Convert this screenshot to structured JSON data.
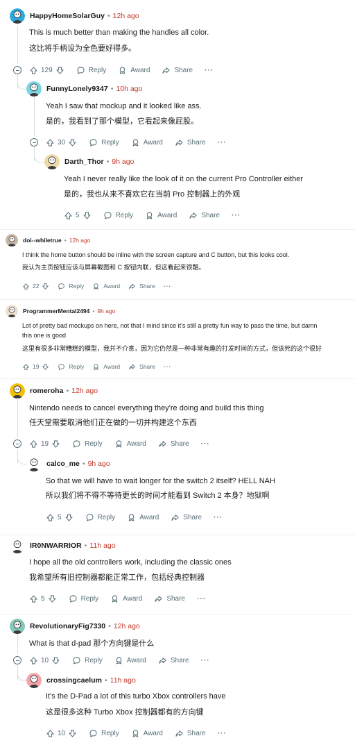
{
  "comments": [
    {
      "user": "HappyHomeSolarGuy",
      "time": "12h ago",
      "en": "This is much better than making the handles all color.",
      "zh": "这比将手柄设为全色要好得多。",
      "votes": "129",
      "reply": "Reply",
      "award": "Award",
      "share": "Share",
      "more": "···"
    },
    {
      "user": "FunnyLonely9347",
      "time": "10h ago",
      "en": "Yeah I saw that mockup and it looked like ass.",
      "zh": "是的，我看到了那个模型，它看起来像屁股。",
      "votes": "30",
      "reply": "Reply",
      "award": "Award",
      "share": "Share",
      "more": "···"
    },
    {
      "user": "Darth_Thor",
      "time": "9h ago",
      "en": "Yeah I never really like the look of it on the current Pro Controller either",
      "zh": "是的，我也从来不喜欢它在当前 Pro 控制器上的外观",
      "votes": "5",
      "reply": "Reply",
      "award": "Award",
      "share": "Share",
      "more": "···"
    },
    {
      "user": "doi--whiletrue",
      "time": "12h ago",
      "en": "I think the home button should be inline with the screen capture and C button, but this looks cool.",
      "zh": "我认为主页按钮应该与屏幕截图和 C 按钮内联，但这看起来很酷。",
      "votes": "22",
      "reply": "Reply",
      "award": "Award",
      "share": "Share",
      "more": "···"
    },
    {
      "user": "ProgrammerMental2494",
      "time": "9h ago",
      "en": "Lot of pretty bad mockups on here, not that I mind since it's still a pretty fun way to pass the time, but damn",
      "en2": "this one is good",
      "zh": "这里有很多非常糟糕的模型，我并不介意，因为它仍然是一种非常有趣的打发时间的方式，但该死的这个很好",
      "votes": "19",
      "reply": "Reply",
      "award": "Award",
      "share": "Share",
      "more": "···"
    },
    {
      "user": "romeroha",
      "time": "12h ago",
      "en": "Nintendo needs to cancel everything they're doing and build this thing",
      "zh": "任天堂需要取消他们正在做的一切并构建这个东西",
      "votes": "19",
      "reply": "Reply",
      "award": "Award",
      "share": "Share",
      "more": "···"
    },
    {
      "user": "calco_me",
      "time": "9h ago",
      "en": "So that we will have to wait longer for the switch 2 itself? HELL NAH",
      "zh": "所以我们将不得不等待更长的时间才能看到 Switch 2 本身？地狱啊",
      "votes": "5",
      "reply": "Reply",
      "award": "Award",
      "share": "Share",
      "more": "···"
    },
    {
      "user": "IR0NWARRIOR",
      "time": "11h ago",
      "en": "I hope all the old controllers work, including the classic ones",
      "zh": "我希望所有旧控制器都能正常工作，包括经典控制器",
      "votes": "5",
      "reply": "Reply",
      "award": "Award",
      "share": "Share",
      "more": "···"
    },
    {
      "user": "RevolutionaryFig7330",
      "time": "12h ago",
      "en": "What is that d-pad   那个方向键是什么",
      "votes": "10",
      "reply": "Reply",
      "award": "Award",
      "share": "Share",
      "more": "···"
    },
    {
      "user": "crossingcaelum",
      "time": "11h ago",
      "en": "It's the D-Pad a lot of this turbo Xbox controllers have",
      "zh": "这是很多这种 Turbo Xbox 控制器都有的方向键",
      "votes": "10",
      "reply": "Reply",
      "award": "Award",
      "share": "Share",
      "more": "···"
    }
  ],
  "dot": "•",
  "colors": {
    "time": "#c0392b",
    "muted": "#576f76",
    "thread": "#d9dde0"
  },
  "icons": [
    "upvote-icon",
    "downvote-icon",
    "reply-icon",
    "award-icon",
    "share-icon",
    "collapse-icon",
    "avatar-icon"
  ]
}
